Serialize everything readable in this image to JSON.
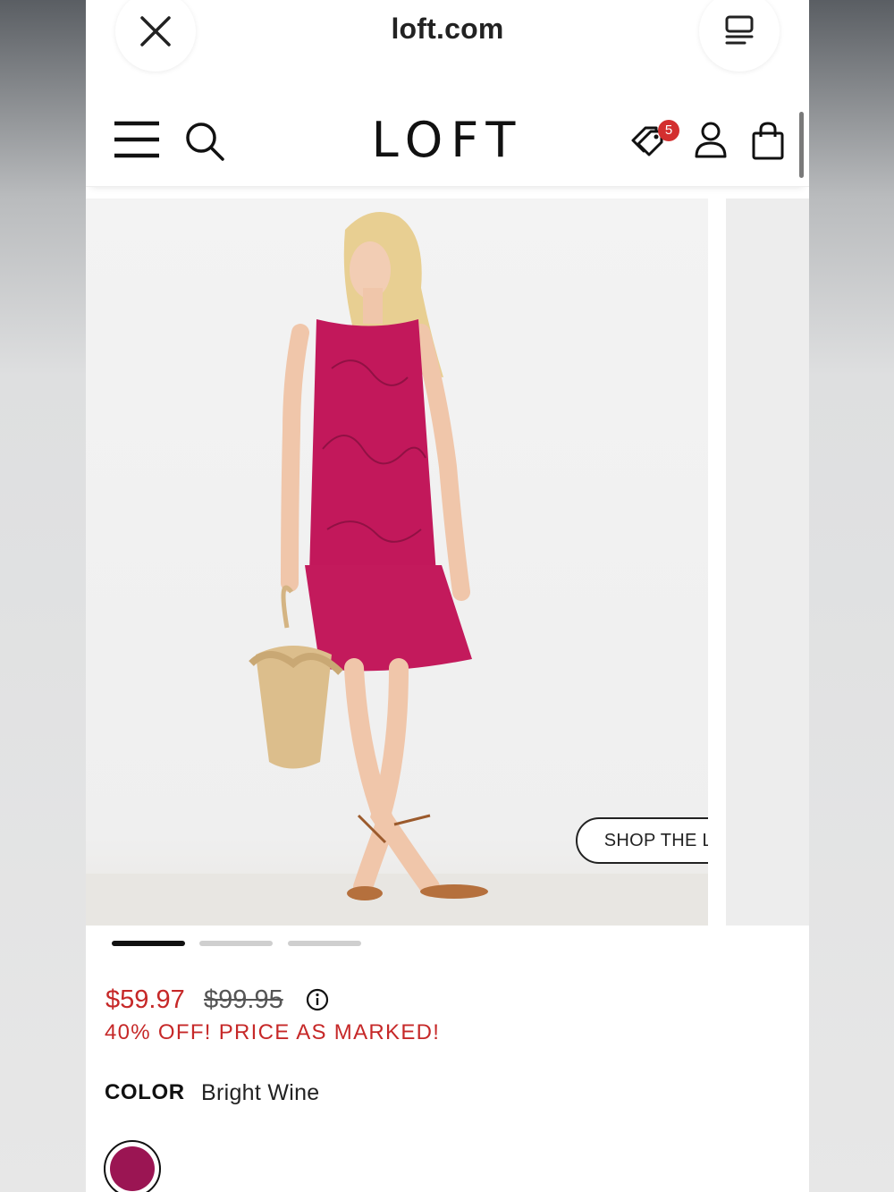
{
  "browser": {
    "url": "loft.com",
    "close_icon": "close-icon",
    "tabs_icon": "tabs-icon"
  },
  "header": {
    "logo": "LOFT",
    "offers_badge": "5",
    "icons": [
      "menu-icon",
      "search-icon",
      "offers-tag-icon",
      "account-icon",
      "bag-icon"
    ]
  },
  "gallery": {
    "shop_the_look": "SHOP THE LOOK",
    "image_count": 3,
    "active_index": 0
  },
  "product": {
    "sale_price": "$59.97",
    "original_price": "$99.95",
    "promo": "40% OFF! PRICE AS MARKED!",
    "color_label": "COLOR",
    "color_value": "Bright Wine",
    "swatch_color": "#9b1553"
  },
  "colors": {
    "sale_red": "#c62828",
    "badge_red": "#d32f2f",
    "dress": "#c2185b"
  }
}
